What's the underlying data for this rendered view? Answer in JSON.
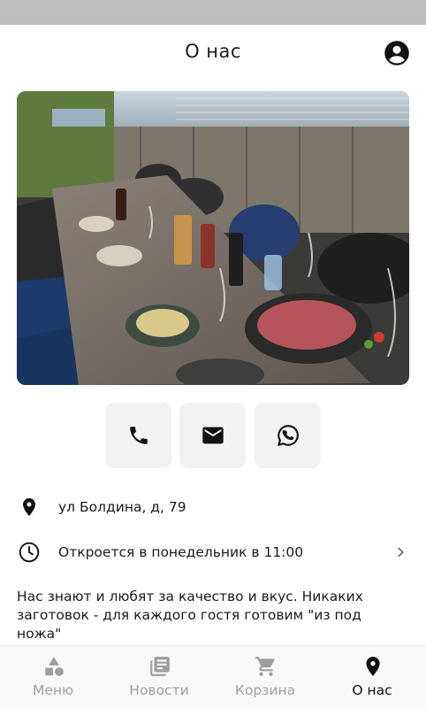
{
  "header": {
    "title": "О нас",
    "profile_icon": "account-circle-icon"
  },
  "hero": {
    "image": "restaurant-terrace-table-photo"
  },
  "contacts": [
    {
      "icon": "phone-icon"
    },
    {
      "icon": "mail-icon"
    },
    {
      "icon": "whatsapp-icon"
    }
  ],
  "info": {
    "address": "ул Болдина, д, 79",
    "hours": "Откроется в понедельник в 11:00"
  },
  "about": {
    "text": "Нас знают и любят за качество и вкус. Никаких заготовок - для каждого гостя готовим \"из под ножа\""
  },
  "nav": {
    "menu": "Меню",
    "news": "Новости",
    "cart": "Корзина",
    "about": "О нас",
    "active": "about"
  },
  "colors": {
    "status_bar": "#bdbdbd",
    "button_bg": "#f2f2f2",
    "nav_inactive": "#9e9e9e",
    "nav_active": "#111111"
  }
}
